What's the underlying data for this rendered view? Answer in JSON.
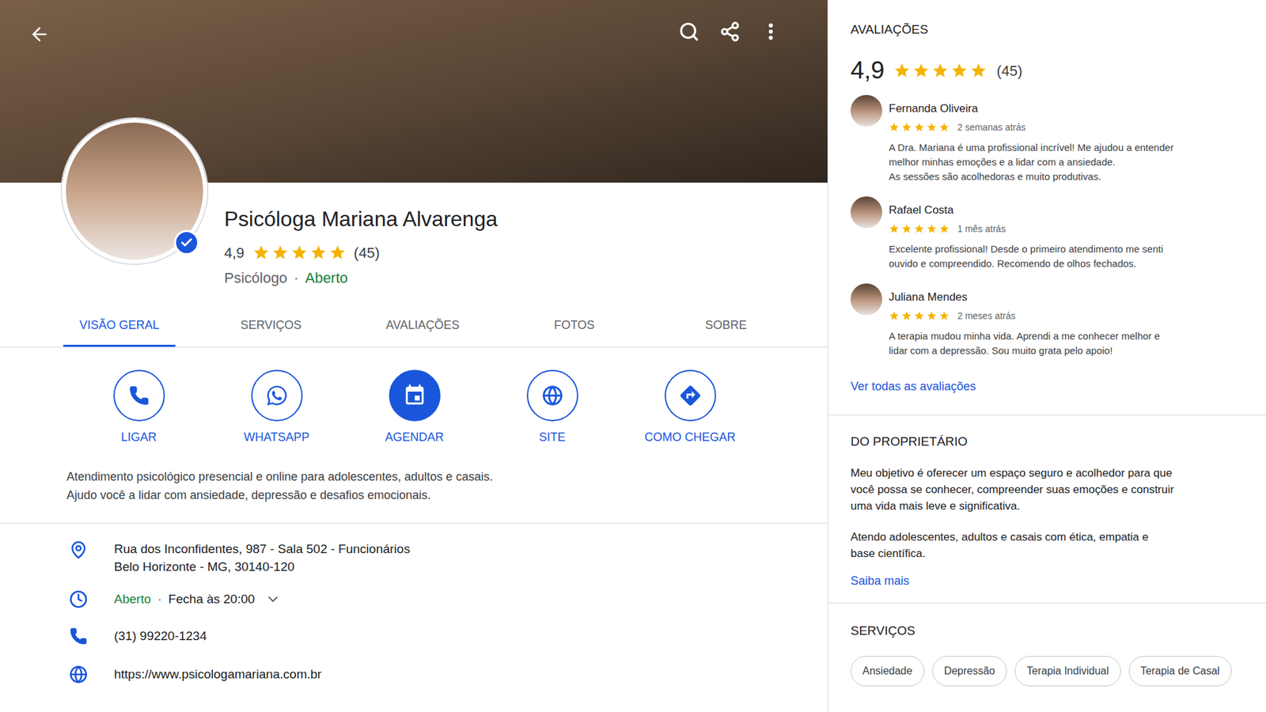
{
  "header": {
    "title": "Psicóloga Mariana Alvarenga",
    "rating": "4,9",
    "stars": 5,
    "review_count": "(45)",
    "category": "Psicólogo",
    "separator": "·",
    "status": "Aberto",
    "verified": true
  },
  "tabs": [
    {
      "label": "VISÃO GERAL",
      "selected": true
    },
    {
      "label": "SERVIÇOS",
      "selected": false
    },
    {
      "label": "AVALIAÇÕES",
      "selected": false
    },
    {
      "label": "FOTOS",
      "selected": false
    },
    {
      "label": "SOBRE",
      "selected": false
    }
  ],
  "actions": [
    {
      "label": "LIGAR",
      "kind": "outline"
    },
    {
      "label": "WHATSAPP",
      "kind": "outline"
    },
    {
      "label": "AGENDAR",
      "kind": "filled"
    },
    {
      "label": "SITE",
      "kind": "outline"
    },
    {
      "label": "COMO CHEGAR",
      "kind": "outline"
    }
  ],
  "description": [
    "Atendimento psicológico presencial e online para adolescentes, adultos e casais.",
    "Ajudo você a lidar com ansiedade, depressão e desafios emocionais."
  ],
  "info": {
    "address": [
      "Rua dos Inconfidentes, 987 - Sala 502 - Funcionários",
      "Belo Horizonte - MG, 30140-120"
    ],
    "hours_status": "Aberto",
    "hours_separator": "·",
    "hours_close": "Fecha às 20:00",
    "hours_expanded": false,
    "phone": "(31) 99220-1234",
    "website": "https://www.psicologamariana.com.br"
  },
  "reviews": {
    "heading": "AVALIAÇÕES",
    "rating": "4,9",
    "stars": 5,
    "count": "(45)",
    "items": [
      {
        "name": "Fernanda Oliveira",
        "stars": 5,
        "time": "2 semanas atrás",
        "text": [
          "A Dra. Mariana é uma profissional incrível! Me ajudou a entender",
          "melhor minhas emoções e a lidar com a ansiedade.",
          "As sessões são acolhedoras e muito produtivas."
        ]
      },
      {
        "name": "Rafael Costa",
        "stars": 5,
        "time": "1 mês atrás",
        "text": [
          "Excelente profissional! Desde o primeiro atendimento me senti",
          "ouvido e compreendido. Recomendo de olhos fechados."
        ]
      },
      {
        "name": "Juliana Mendes",
        "stars": 5,
        "time": "2 meses atrás",
        "text": [
          "A terapia mudou minha vida. Aprendi a me conhecer melhor e",
          "lidar com a depressão. Sou muito grata pelo apoio!"
        ]
      }
    ],
    "link": "Ver todas as avaliações"
  },
  "owner": {
    "heading": "DO PROPRIETÁRIO",
    "paragraphs": [
      [
        "Meu objetivo é oferecer um espaço seguro e acolhedor para que",
        "você possa se conhecer, compreender suas emoções e construir",
        "uma vida mais leve e significativa."
      ],
      [
        "Atendo adolescentes, adultos e casais com ética, empatia e",
        "base científica."
      ]
    ],
    "link": "Saiba mais"
  },
  "services": {
    "heading": "SERVIÇOS",
    "chips": [
      "Ansiedade",
      "Depressão",
      "Terapia Individual",
      "Terapia de Casal"
    ]
  }
}
